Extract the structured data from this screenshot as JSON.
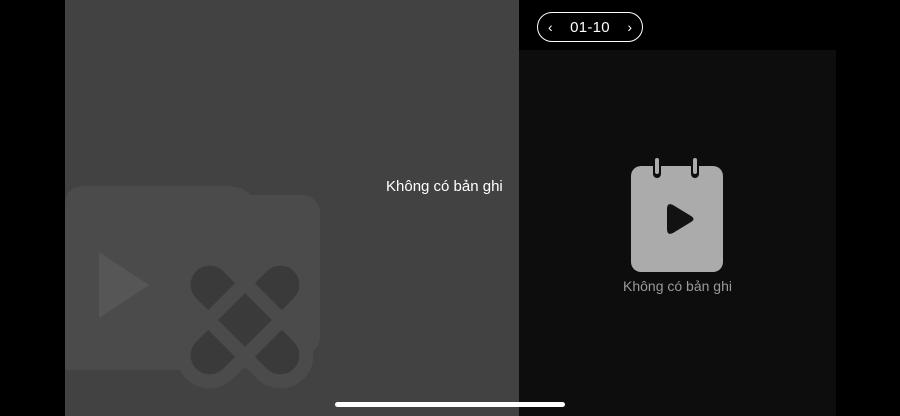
{
  "video_panel": {
    "empty_message": "Không có bản ghi"
  },
  "pager": {
    "prev_icon": "chevron-left-icon",
    "label": "01-10",
    "next_icon": "chevron-right-icon"
  },
  "recordings_panel": {
    "empty_icon": "calendar-video-icon",
    "empty_message": "Không có bản ghi"
  },
  "colors": {
    "video_panel_bg": "#424242",
    "recordings_bg": "#0d0d0d",
    "empty_text_secondary": "#9a9a9a"
  }
}
